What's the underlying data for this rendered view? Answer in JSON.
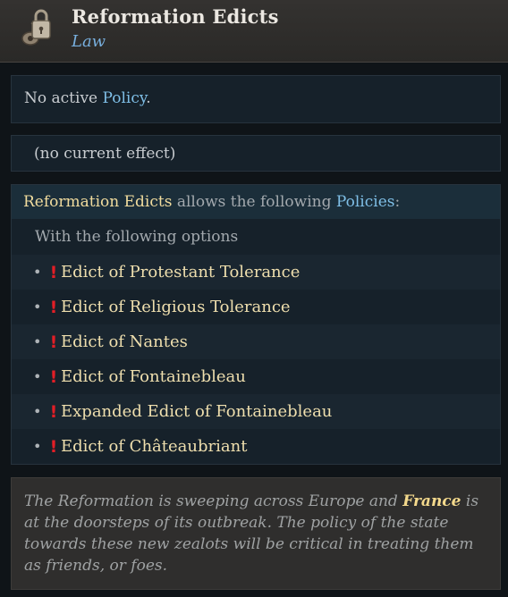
{
  "header": {
    "icon": "key-lock-icon",
    "title": "Reformation Edicts",
    "subtitle": "Law"
  },
  "policy_status": {
    "prefix": "No active ",
    "link": "Policy",
    "suffix": "."
  },
  "effect": {
    "text": "(no current effect)"
  },
  "allows": {
    "subject": "Reformation Edicts",
    "middle": " allows the following ",
    "link": "Policies",
    "suffix": ":",
    "options_label": "With the following options",
    "options": [
      "Edict of Protestant Tolerance",
      "Edict of Religious Tolerance",
      "Edict of Nantes",
      "Edict of Fontainebleau",
      "Expanded Edict of Fontainebleau",
      "Edict of Châteaubriant"
    ]
  },
  "flavor": {
    "part1": "The Reformation is sweeping across Europe and ",
    "highlight": "France",
    "part2": " is at the doorsteps of its outbreak. The policy of the state towards these new zealots will be critical in treating them as friends, or foes."
  },
  "colors": {
    "link_blue": "#7fbfe7",
    "option_gold": "#efdfae",
    "warning_red": "#e21e26",
    "highlight_gold": "#f4d98c"
  }
}
